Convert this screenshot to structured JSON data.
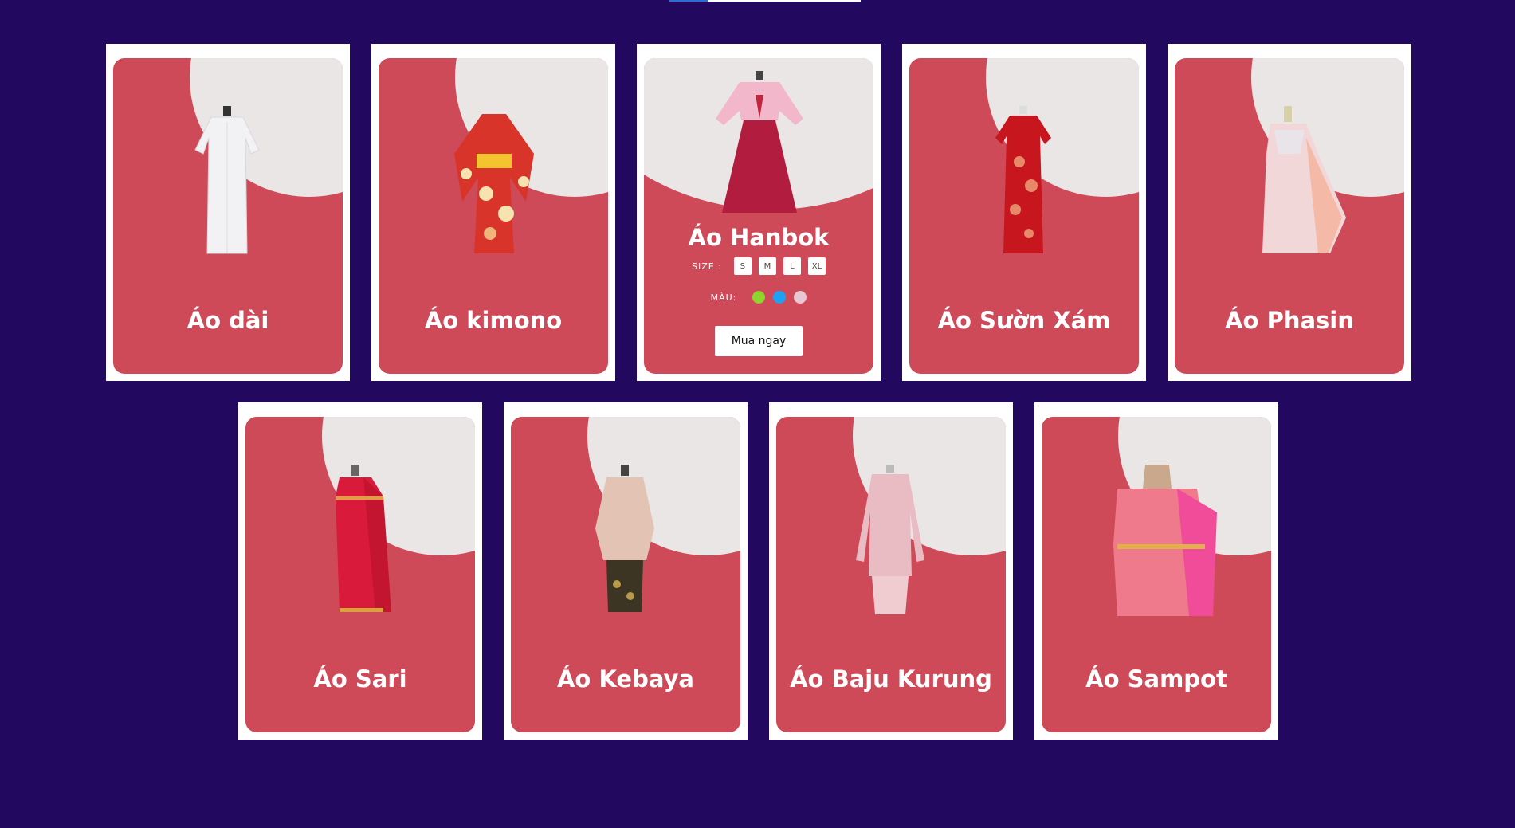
{
  "products": [
    {
      "name": "Áo dài"
    },
    {
      "name": "Áo kimono"
    },
    {
      "name": "Áo Hanbok"
    },
    {
      "name": "Áo Sườn Xám"
    },
    {
      "name": "Áo Phasin"
    },
    {
      "name": "Áo Sari"
    },
    {
      "name": "Áo Kebaya"
    },
    {
      "name": "Áo Baju Kurung"
    },
    {
      "name": "Áo Sampot"
    }
  ],
  "active_card": {
    "size_label": "SIZE :",
    "sizes": [
      "S",
      "M",
      "L",
      "XL"
    ],
    "color_label": "MÀU:",
    "colors": [
      "#8fd62c",
      "#1ea1f2",
      "#e8c6d3"
    ],
    "buy_label": "Mua ngay"
  },
  "theme": {
    "background": "#22085e",
    "card_red": "#cf4a58",
    "circle": "#ebe6e6"
  }
}
